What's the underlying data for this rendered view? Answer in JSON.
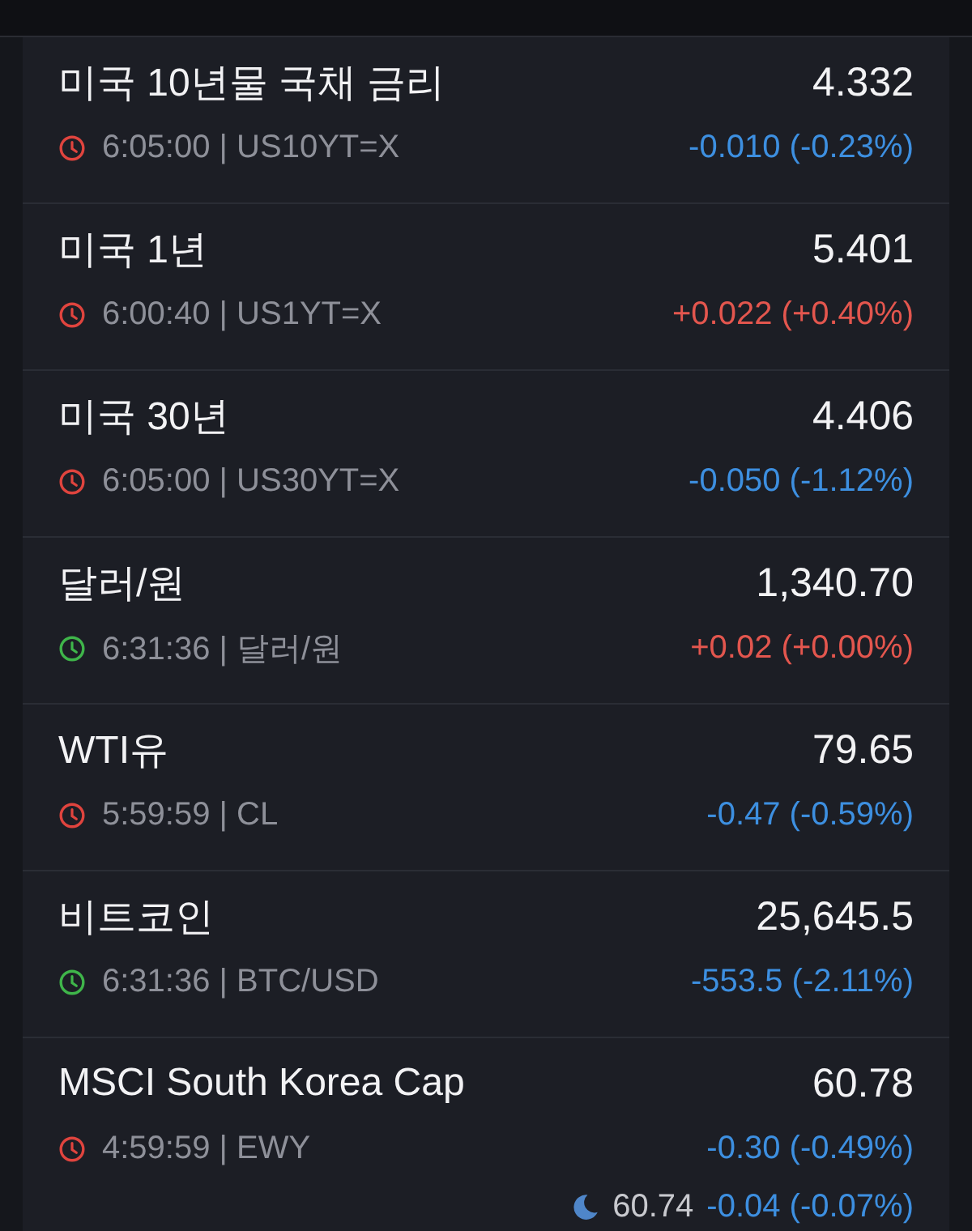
{
  "quotes": [
    {
      "name": "미국 10년물 국채 금리",
      "price": "4.332",
      "detail": "6:05:00 | US10YT=X",
      "color": "#e0443e",
      "positive": false,
      "change": "-0.010 (-0.23%)"
    },
    {
      "name": "미국 1년",
      "price": "5.401",
      "detail": "6:00:40 | US1YT=X",
      "color": "#e0443e",
      "positive": true,
      "change": "+0.022 (+0.40%)"
    },
    {
      "name": "미국 30년",
      "price": "4.406",
      "detail": "6:05:00 | US30YT=X",
      "color": "#e0443e",
      "positive": false,
      "change": "-0.050 (-1.12%)"
    },
    {
      "name": "달러/원",
      "price": "1,340.70",
      "detail": "6:31:36 | 달러/원",
      "color": "#3fb54a",
      "positive": true,
      "change": "+0.02 (+0.00%)"
    },
    {
      "name": "WTI유",
      "price": "79.65",
      "detail": "5:59:59 | CL",
      "color": "#e0443e",
      "positive": false,
      "change": "-0.47 (-0.59%)"
    },
    {
      "name": "비트코인",
      "price": "25,645.5",
      "detail": "6:31:36 | BTC/USD",
      "color": "#3fb54a",
      "positive": false,
      "change": "-553.5 (-2.11%)"
    },
    {
      "name": "MSCI South Korea Cap",
      "price": "60.78",
      "detail": "4:59:59 | EWY",
      "color": "#e0443e",
      "positive": false,
      "change": "-0.30 (-0.49%)",
      "after_hours": {
        "price": "60.74",
        "positive": false,
        "change": "-0.04 (-0.07%)"
      }
    }
  ]
}
